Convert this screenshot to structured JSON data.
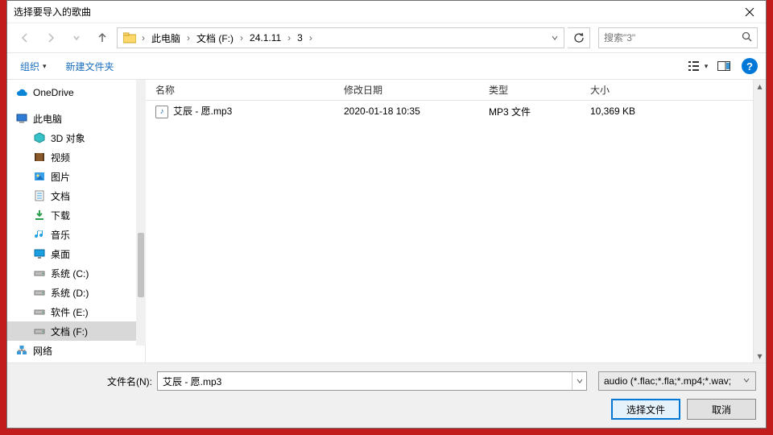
{
  "title": "选择要导入的歌曲",
  "breadcrumb": [
    "此电脑",
    "文档 (F:)",
    "24.1.11",
    "3"
  ],
  "search_placeholder": "搜索\"3\"",
  "toolbar": {
    "organize": "组织",
    "new_folder": "新建文件夹"
  },
  "columns": {
    "name": "名称",
    "date": "修改日期",
    "type": "类型",
    "size": "大小"
  },
  "tree": [
    {
      "label": "OneDrive",
      "icon": "cloud",
      "indent": false
    },
    {
      "label": "此电脑",
      "icon": "pc",
      "indent": false
    },
    {
      "label": "3D 对象",
      "icon": "obj3d",
      "indent": true
    },
    {
      "label": "视频",
      "icon": "video",
      "indent": true
    },
    {
      "label": "图片",
      "icon": "picture",
      "indent": true
    },
    {
      "label": "文档",
      "icon": "doc",
      "indent": true
    },
    {
      "label": "下载",
      "icon": "download",
      "indent": true
    },
    {
      "label": "音乐",
      "icon": "music",
      "indent": true
    },
    {
      "label": "桌面",
      "icon": "desktop",
      "indent": true
    },
    {
      "label": "系统 (C:)",
      "icon": "drive",
      "indent": true
    },
    {
      "label": "系统 (D:)",
      "icon": "drive",
      "indent": true
    },
    {
      "label": "软件 (E:)",
      "icon": "drive",
      "indent": true
    },
    {
      "label": "文档 (F:)",
      "icon": "drive",
      "indent": true,
      "selected": true
    },
    {
      "label": "网络",
      "icon": "net",
      "indent": false
    }
  ],
  "files": [
    {
      "name": "艾辰 - 愿.mp3",
      "date": "2020-01-18 10:35",
      "type": "MP3 文件",
      "size": "10,369 KB"
    }
  ],
  "filename_label": "文件名(N):",
  "filename_value": "艾辰 - 愿.mp3",
  "filter_label": "audio (*.flac;*.fla;*.mp4;*.wav;",
  "open_btn": "选择文件",
  "cancel_btn": "取消"
}
